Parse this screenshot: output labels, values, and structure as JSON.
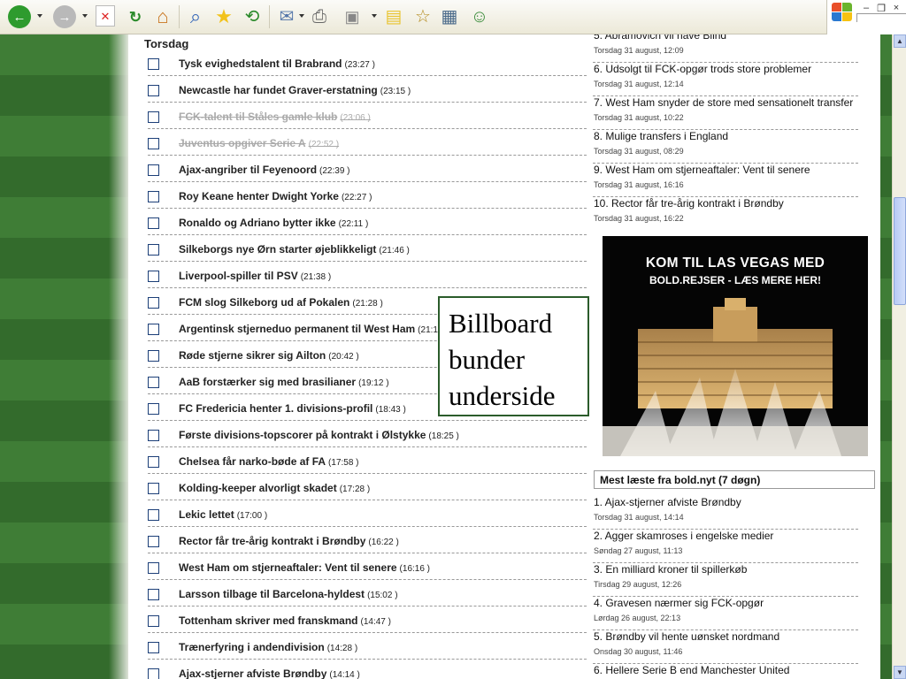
{
  "toolbar": {
    "buttons": [
      {
        "name": "back-button",
        "glyph": "←"
      },
      {
        "name": "forward-button",
        "glyph": "→"
      },
      {
        "name": "stop-button",
        "glyph": "✕"
      },
      {
        "name": "refresh-button",
        "glyph": "↻"
      },
      {
        "name": "home-button",
        "glyph": "⌂"
      },
      {
        "name": "search-button",
        "glyph": "⌕"
      },
      {
        "name": "favorites-button",
        "glyph": "★"
      },
      {
        "name": "history-button",
        "glyph": "⟲"
      },
      {
        "name": "mail-button",
        "glyph": "✉"
      },
      {
        "name": "print-button",
        "glyph": "⎙"
      },
      {
        "name": "edit-button",
        "glyph": "▣"
      },
      {
        "name": "discuss-button",
        "glyph": "▤"
      },
      {
        "name": "research-button",
        "glyph": "☆"
      },
      {
        "name": "media-button",
        "glyph": "▦"
      },
      {
        "name": "messenger-button",
        "glyph": "☺"
      }
    ],
    "window_controls": [
      "–",
      "❐",
      "×"
    ]
  },
  "left": {
    "day_heading": "Torsdag",
    "news": [
      {
        "title": "Tysk evighedstalent til Brabrand",
        "time": "(23:27 )",
        "visited": false
      },
      {
        "title": "Newcastle har fundet Graver-erstatning",
        "time": "(23:15 )",
        "visited": false
      },
      {
        "title": "FCK-talent til Ståles gamle klub",
        "time": "(23:06 )",
        "visited": true
      },
      {
        "title": "Juventus opgiver Serie A",
        "time": "(22:52 )",
        "visited": true
      },
      {
        "title": "Ajax-angriber til Feyenoord",
        "time": "(22:39 )",
        "visited": false
      },
      {
        "title": "Roy Keane henter Dwight Yorke",
        "time": "(22:27 )",
        "visited": false
      },
      {
        "title": "Ronaldo og Adriano bytter ikke",
        "time": "(22:11 )",
        "visited": false
      },
      {
        "title": "Silkeborgs nye Ørn starter øjeblikkeligt",
        "time": "(21:46 )",
        "visited": false
      },
      {
        "title": "Liverpool-spiller til PSV",
        "time": "(21:38 )",
        "visited": false
      },
      {
        "title": "FCM slog Silkeborg ud af Pokalen",
        "time": "(21:28 )",
        "visited": false
      },
      {
        "title": "Argentinsk stjerneduo permanent til West Ham",
        "time": "(21:1",
        "visited": false
      },
      {
        "title": "Røde stjerne sikrer sig Ailton",
        "time": "(20:42 )",
        "visited": false
      },
      {
        "title": "AaB forstærker sig med brasilianer",
        "time": "(19:12 )",
        "visited": false
      },
      {
        "title": "FC Fredericia henter 1. divisions-profil",
        "time": "(18:43 )",
        "visited": false
      },
      {
        "title": "Første divisions-topscorer på kontrakt i Ølstykke",
        "time": "(18:25 )",
        "visited": false
      },
      {
        "title": "Chelsea får narko-bøde af FA",
        "time": "(17:58 )",
        "visited": false
      },
      {
        "title": "Kolding-keeper alvorligt skadet",
        "time": "(17:28 )",
        "visited": false
      },
      {
        "title": "Lekic lettet",
        "time": "(17:00 )",
        "visited": false
      },
      {
        "title": "Rector får tre-årig kontrakt i Brøndby",
        "time": "(16:22 )",
        "visited": false
      },
      {
        "title": "West Ham om stjerneaftaler: Vent til senere",
        "time": "(16:16 )",
        "visited": false
      },
      {
        "title": "Larsson tilbage til Barcelona-hyldest",
        "time": "(15:02 )",
        "visited": false
      },
      {
        "title": "Tottenham skriver med franskmand",
        "time": "(14:47 )",
        "visited": false
      },
      {
        "title": "Trænerfyring i andendivision",
        "time": "(14:28 )",
        "visited": false
      },
      {
        "title": "Ajax-stjerner afviste Brøndby",
        "time": "(14:14 )",
        "visited": false
      }
    ],
    "billboard": "Billboard bunder underside"
  },
  "right": {
    "top_list": [
      {
        "title": "5. Abramovich vil have Blind",
        "date": "Torsdag 31 august, 12:09"
      },
      {
        "title": "6. Udsolgt til FCK-opgør trods store problemer",
        "date": "Torsdag 31 august, 12:14"
      },
      {
        "title": "7. West Ham snyder de store med sensationelt transfer",
        "date": "Torsdag 31 august, 10:22"
      },
      {
        "title": "8. Mulige transfers i England",
        "date": "Torsdag 31 august, 08:29"
      },
      {
        "title": "9. West Ham om stjerneaftaler: Vent til senere",
        "date": "Torsdag 31 august, 16:16"
      },
      {
        "title": "10. Rector får tre-årig kontrakt i Brøndby",
        "date": "Torsdag 31 august, 16:22"
      }
    ],
    "ad": {
      "line1": "KOM TIL LAS VEGAS MED",
      "line2": "BOLD.REJSER - LÆS MERE HER!"
    },
    "most_read_header": "Mest læste fra bold.nyt (7 døgn)",
    "most_read": [
      {
        "title": "1. Ajax-stjerner afviste Brøndby",
        "date": "Torsdag 31 august, 14:14"
      },
      {
        "title": "2. Agger skamroses i engelske medier",
        "date": "Søndag 27 august, 11:13"
      },
      {
        "title": "3. En milliard kroner til spillerkøb",
        "date": "Tirsdag 29 august, 12:26"
      },
      {
        "title": "4. Gravesen nærmer sig FCK-opgør",
        "date": "Lørdag 26 august, 22:13"
      },
      {
        "title": "5. Brøndby vil hente uønsket nordmand",
        "date": "Onsdag 30 august, 11:46"
      },
      {
        "title": "6. Hellere Serie B end Manchester United",
        "date": ""
      }
    ]
  },
  "colors": {
    "field_green": "#3f7d36",
    "checkbox_border": "#1c3f78",
    "billboard_border": "#2b5c2b"
  }
}
